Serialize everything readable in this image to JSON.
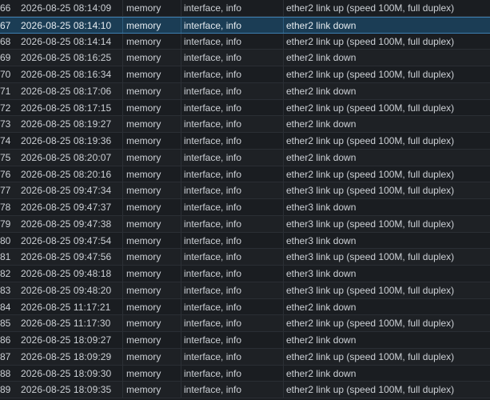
{
  "log": {
    "selected_row_id": "67",
    "rows": [
      {
        "id": "66",
        "time": "2026-08-25 08:14:09",
        "buffer": "memory",
        "topics": "interface, info",
        "message": "ether2 link up (speed 100M, full duplex)"
      },
      {
        "id": "67",
        "time": "2026-08-25 08:14:10",
        "buffer": "memory",
        "topics": "interface, info",
        "message": "ether2 link down"
      },
      {
        "id": "68",
        "time": "2026-08-25 08:14:14",
        "buffer": "memory",
        "topics": "interface, info",
        "message": "ether2 link up (speed 100M, full duplex)"
      },
      {
        "id": "69",
        "time": "2026-08-25 08:16:25",
        "buffer": "memory",
        "topics": "interface, info",
        "message": "ether2 link down"
      },
      {
        "id": "70",
        "time": "2026-08-25 08:16:34",
        "buffer": "memory",
        "topics": "interface, info",
        "message": "ether2 link up (speed 100M, full duplex)"
      },
      {
        "id": "71",
        "time": "2026-08-25 08:17:06",
        "buffer": "memory",
        "topics": "interface, info",
        "message": "ether2 link down"
      },
      {
        "id": "72",
        "time": "2026-08-25 08:17:15",
        "buffer": "memory",
        "topics": "interface, info",
        "message": "ether2 link up (speed 100M, full duplex)"
      },
      {
        "id": "73",
        "time": "2026-08-25 08:19:27",
        "buffer": "memory",
        "topics": "interface, info",
        "message": "ether2 link down"
      },
      {
        "id": "74",
        "time": "2026-08-25 08:19:36",
        "buffer": "memory",
        "topics": "interface, info",
        "message": "ether2 link up (speed 100M, full duplex)"
      },
      {
        "id": "75",
        "time": "2026-08-25 08:20:07",
        "buffer": "memory",
        "topics": "interface, info",
        "message": "ether2 link down"
      },
      {
        "id": "76",
        "time": "2026-08-25 08:20:16",
        "buffer": "memory",
        "topics": "interface, info",
        "message": "ether2 link up (speed 100M, full duplex)"
      },
      {
        "id": "77",
        "time": "2026-08-25 09:47:34",
        "buffer": "memory",
        "topics": "interface, info",
        "message": "ether3 link up (speed 100M, full duplex)"
      },
      {
        "id": "78",
        "time": "2026-08-25 09:47:37",
        "buffer": "memory",
        "topics": "interface, info",
        "message": "ether3 link down"
      },
      {
        "id": "79",
        "time": "2026-08-25 09:47:38",
        "buffer": "memory",
        "topics": "interface, info",
        "message": "ether3 link up (speed 100M, full duplex)"
      },
      {
        "id": "80",
        "time": "2026-08-25 09:47:54",
        "buffer": "memory",
        "topics": "interface, info",
        "message": "ether3 link down"
      },
      {
        "id": "81",
        "time": "2026-08-25 09:47:56",
        "buffer": "memory",
        "topics": "interface, info",
        "message": "ether3 link up (speed 100M, full duplex)"
      },
      {
        "id": "82",
        "time": "2026-08-25 09:48:18",
        "buffer": "memory",
        "topics": "interface, info",
        "message": "ether3 link down"
      },
      {
        "id": "83",
        "time": "2026-08-25 09:48:20",
        "buffer": "memory",
        "topics": "interface, info",
        "message": "ether3 link up (speed 100M, full duplex)"
      },
      {
        "id": "84",
        "time": "2026-08-25 11:17:21",
        "buffer": "memory",
        "topics": "interface, info",
        "message": "ether2 link down"
      },
      {
        "id": "85",
        "time": "2026-08-25 11:17:30",
        "buffer": "memory",
        "topics": "interface, info",
        "message": "ether2 link up (speed 100M, full duplex)"
      },
      {
        "id": "86",
        "time": "2026-08-25 18:09:27",
        "buffer": "memory",
        "topics": "interface, info",
        "message": "ether2 link down"
      },
      {
        "id": "87",
        "time": "2026-08-25 18:09:29",
        "buffer": "memory",
        "topics": "interface, info",
        "message": "ether2 link up (speed 100M, full duplex)"
      },
      {
        "id": "88",
        "time": "2026-08-25 18:09:30",
        "buffer": "memory",
        "topics": "interface, info",
        "message": "ether2 link down"
      },
      {
        "id": "89",
        "time": "2026-08-25 18:09:35",
        "buffer": "memory",
        "topics": "interface, info",
        "message": "ether2 link up (speed 100M, full duplex)"
      }
    ]
  }
}
